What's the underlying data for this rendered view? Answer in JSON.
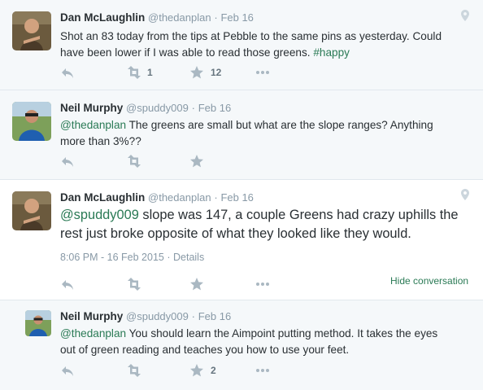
{
  "tweets": [
    {
      "name": "Dan McLaughlin",
      "handle": "@thedanplan",
      "sep": "·",
      "date": "Feb 16",
      "text_line1": "Shot an 83 today from the tips at Pebble to the same pins as yesterday. Could",
      "text_line2": "have been lower if I was able to read those greens. ",
      "hashtag": "#happy",
      "retweet_count": "1",
      "favorite_count": "12"
    },
    {
      "name": "Neil Murphy",
      "handle": "@spuddy009",
      "sep": "·",
      "date": "Feb 16",
      "mention": "@thedanplan",
      "text_line1_rest": " The greens are small but what are the slope ranges? Anything",
      "text_line2": "more than 3%??"
    },
    {
      "name": "Dan McLaughlin",
      "handle": "@thedanplan",
      "sep": "·",
      "date": "Feb 16",
      "mention": "@spuddy009",
      "text_line1_rest": " slope was 147, a couple Greens had crazy uphills the",
      "text_line2": "rest just broke opposite of what they looked like they would.",
      "timestamp": "8:06 PM - 16 Feb 2015",
      "details_sep": "·",
      "details": "Details",
      "hide_conversation": "Hide conversation"
    },
    {
      "name": "Neil Murphy",
      "handle": "@spuddy009",
      "sep": "·",
      "date": "Feb 16",
      "mention": "@thedanplan",
      "text_line1_rest": " You should learn  the Aimpoint putting method. It takes the eyes",
      "text_line2": "out of green reading and teaches you how to use your feet.",
      "favorite_count": "2"
    }
  ],
  "icons": {
    "reply": "reply-icon",
    "retweet": "retweet-icon",
    "favorite": "star-icon",
    "more": "more-icon",
    "location": "location-pin-icon"
  },
  "colors": {
    "link": "#2a7a55",
    "muted": "#8899a6",
    "icon": "#aab8c2"
  }
}
